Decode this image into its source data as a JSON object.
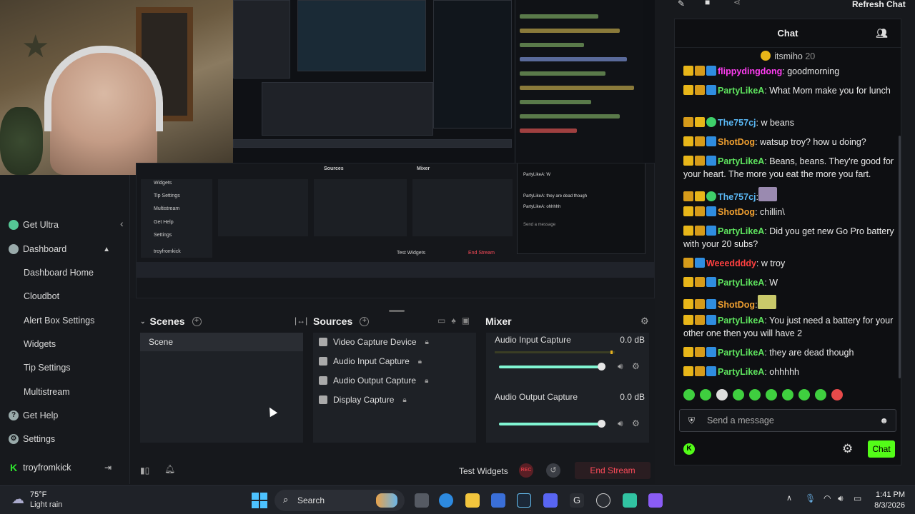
{
  "sidebar": {
    "items": [
      {
        "label": "Get Ultra",
        "icon": "ultra-icon"
      },
      {
        "label": "Dashboard",
        "icon": "dashboard-icon"
      },
      {
        "label": "Dashboard Home"
      },
      {
        "label": "Cloudbot"
      },
      {
        "label": "Alert Box Settings"
      },
      {
        "label": "Widgets"
      },
      {
        "label": "Tip Settings"
      },
      {
        "label": "Multistream"
      },
      {
        "label": "Get Help",
        "icon": "help-icon"
      },
      {
        "label": "Settings",
        "icon": "gear-icon"
      }
    ],
    "user": "troyfromkick"
  },
  "editor": {
    "scenes": {
      "title": "Scenes",
      "items": [
        "Scene"
      ]
    },
    "sources": {
      "title": "Sources",
      "items": [
        "Video Capture Device",
        "Audio Input Capture",
        "Audio Output Capture",
        "Display Capture"
      ]
    },
    "mixer": {
      "title": "Mixer",
      "channels": [
        {
          "name": "Audio Input Capture",
          "db": "0.0 dB",
          "level": 1.0
        },
        {
          "name": "Audio Output Capture",
          "db": "0.0 dB",
          "level": 1.0
        }
      ]
    },
    "test_widgets": "Test Widgets",
    "rec": "REC",
    "end_stream": "End Stream"
  },
  "chat": {
    "top_button": "Refresh Chat",
    "title": "Chat",
    "pinned": {
      "user": "itsmiho",
      "count": "20"
    },
    "messages": [
      {
        "user": "flippydingdong",
        "text": ": goodmorning",
        "color": "#ff3df2"
      },
      {
        "user": "PartyLikeA",
        "text": ": What Mom make you for lunch",
        "color": "#5ee35e"
      },
      {
        "user": "The757cj",
        "text": ": w beans",
        "color": "#5ab8f5"
      },
      {
        "user": "ShotDog",
        "text": ": watsup troy? how u doing?",
        "color": "#f0a030"
      },
      {
        "user": "PartyLikeA",
        "text": ": Beans, beans. They're good for your heart. The more you eat the more you fart.",
        "color": "#5ee35e"
      },
      {
        "user": "The757cj",
        "text": ":",
        "color": "#5ab8f5"
      },
      {
        "user": "ShotDog",
        "text": ": chillin\\",
        "color": "#f0a030"
      },
      {
        "user": "PartyLikeA",
        "text": ": Did you get new Go Pro battery with your 20 subs?",
        "color": "#5ee35e"
      },
      {
        "user": "Weeeddddy",
        "text": ": w troy",
        "color": "#ff4040"
      },
      {
        "user": "PartyLikeA",
        "text": ": W",
        "color": "#5ee35e"
      },
      {
        "user": "ShotDog",
        "text": ":",
        "color": "#f0a030"
      },
      {
        "user": "PartyLikeA",
        "text": ": You just need a battery for your other one then you will have 2",
        "color": "#5ee35e"
      },
      {
        "user": "PartyLikeA",
        "text": ": they are dead though",
        "color": "#5ee35e"
      },
      {
        "user": "PartyLikeA",
        "text": ": ohhhhh",
        "color": "#5ee35e"
      }
    ],
    "input_placeholder": "Send a message",
    "send_button": "Chat"
  },
  "taskbar": {
    "weather_temp": "75°F",
    "weather_desc": "Light rain",
    "search": "Search",
    "time": "1:41 PM",
    "date": "8/3/2026"
  }
}
